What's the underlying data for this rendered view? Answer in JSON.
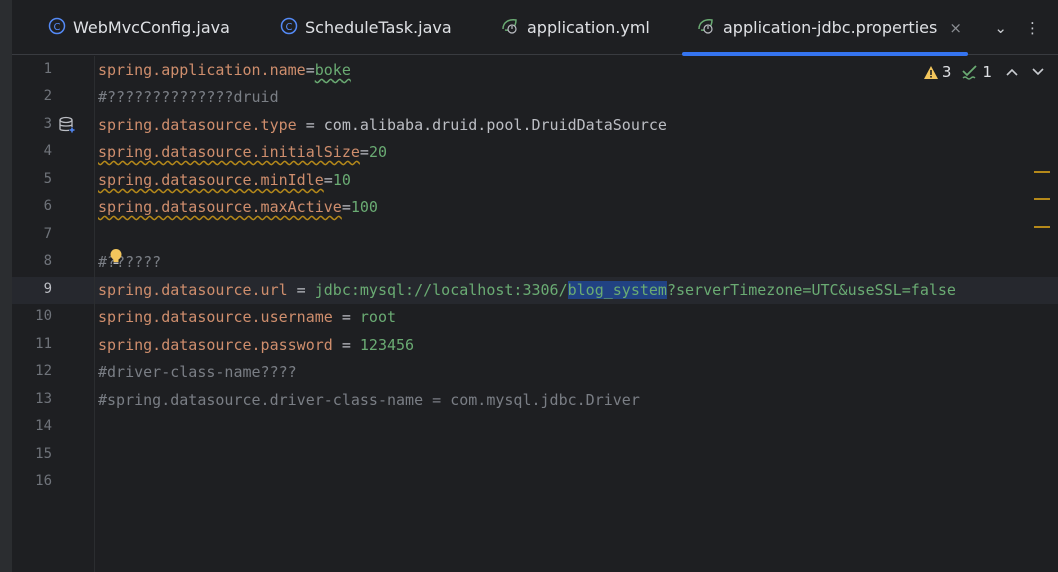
{
  "tabs": [
    {
      "label": "WebMvcConfig.java",
      "icon": "java-class-icon"
    },
    {
      "label": "ScheduleTask.java",
      "icon": "java-class-icon"
    },
    {
      "label": "application.yml",
      "icon": "spring-config-icon"
    },
    {
      "label": "application-jdbc.properties",
      "icon": "spring-config-icon",
      "active": true,
      "close": "×"
    }
  ],
  "tab_actions": {
    "chevron": "⌄",
    "more": "⋮"
  },
  "inspections": {
    "warnings": "3",
    "weak_warnings": "1"
  },
  "gutter": {
    "line_numbers": [
      "1",
      "2",
      "3",
      "4",
      "5",
      "6",
      "7",
      "8",
      "9",
      "10",
      "11",
      "12",
      "13",
      "14",
      "15",
      "16"
    ],
    "current_line": "9"
  },
  "code": {
    "l1": {
      "key": "spring.application.name",
      "eq": "=",
      "val": "boke"
    },
    "l2": {
      "comment": "#??????????????druid"
    },
    "l3": {
      "key": "spring.datasource.type",
      "eq": " = ",
      "val": "com.alibaba.druid.pool.DruidDataSource"
    },
    "l4": {
      "key": "spring.datasource.initialSize",
      "eq": "=",
      "val": "20"
    },
    "l5": {
      "key": "spring.datasource.minIdle",
      "eq": "=",
      "val": "10"
    },
    "l6": {
      "key": "spring.datasource.maxActive",
      "eq": "=",
      "val": "100"
    },
    "l8": {
      "comment": "#??????"
    },
    "l9": {
      "key": "spring.datasource.url",
      "eq": " = ",
      "val_a": "jdbc:mysql://localhost:3306/",
      "val_sel": "blog_system",
      "val_b": "?serverTimezone=UTC&useSSL=false"
    },
    "l10": {
      "key": "spring.datasource.username",
      "eq": " = ",
      "val": "root"
    },
    "l11": {
      "key": "spring.datasource.password",
      "eq": " = ",
      "val": "123456"
    },
    "l12": {
      "comment": "#driver-class-name????"
    },
    "l13": {
      "comment": "#spring.datasource.driver-class-name = com.mysql.jdbc.Driver"
    }
  },
  "colors": {
    "background": "#1e1f22",
    "keyword": "#cf8e6d",
    "value": "#6aab73",
    "comment": "#7a7e85",
    "selection": "#214283",
    "accent": "#3574f0"
  }
}
